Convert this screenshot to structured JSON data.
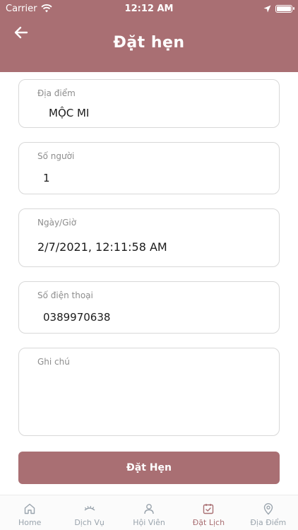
{
  "status_bar": {
    "carrier": "Carrier",
    "time": "12:12 AM"
  },
  "header": {
    "title": "Đặt hẹn"
  },
  "form": {
    "location": {
      "label": "Địa điểm",
      "value": "MỘC MI"
    },
    "people": {
      "label": "Số người",
      "value": "1"
    },
    "datetime": {
      "label": "Ngày/Giờ",
      "value": "2/7/2021, 12:11:58 AM"
    },
    "phone": {
      "label": "Số điện thoại",
      "value": "0389970638"
    },
    "note": {
      "label": "Ghi chú",
      "value": ""
    }
  },
  "submit_label": "Đặt Hẹn",
  "tabs": [
    {
      "label": "Home",
      "icon": "home-icon"
    },
    {
      "label": "Dịch Vụ",
      "icon": "eyelash-icon"
    },
    {
      "label": "Hội Viên",
      "icon": "member-icon"
    },
    {
      "label": "Đặt Lịch",
      "icon": "calendar-check-icon",
      "active": true
    },
    {
      "label": "Địa Điểm",
      "icon": "location-pin-icon"
    }
  ],
  "colors": {
    "accent": "#a96f73",
    "tab_inactive": "#9aa4ad"
  }
}
